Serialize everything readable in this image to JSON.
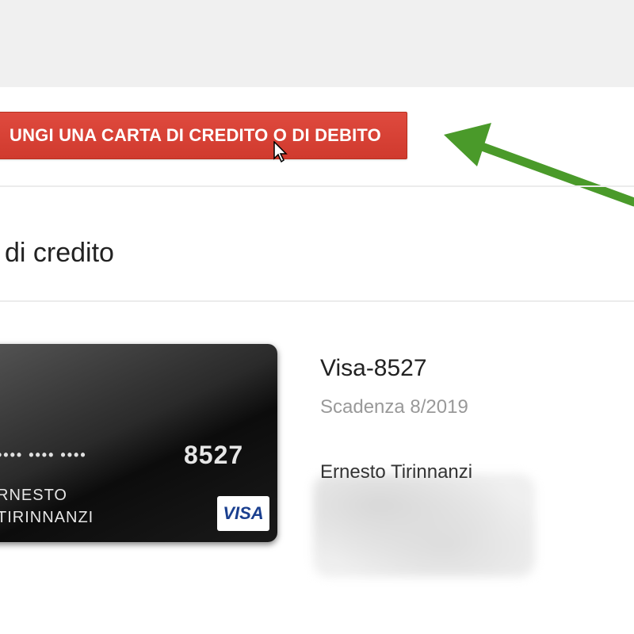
{
  "toolbar": {
    "add_card_label": "UNGI UNA CARTA DI CREDITO O DI DEBITO"
  },
  "section": {
    "title": "di credito"
  },
  "card": {
    "masked_groups": "•••• •••• ••••",
    "last4": "8527",
    "holder_line1": "RNESTO",
    "holder_line2": "TIRINNANZI",
    "network_logo": "VISA"
  },
  "details": {
    "name": "Visa-8527",
    "expiry": "Scadenza 8/2019",
    "owner": "Ernesto Tirinnanzi"
  },
  "colors": {
    "button": "#d64236",
    "arrow": "#4a9a2a"
  }
}
